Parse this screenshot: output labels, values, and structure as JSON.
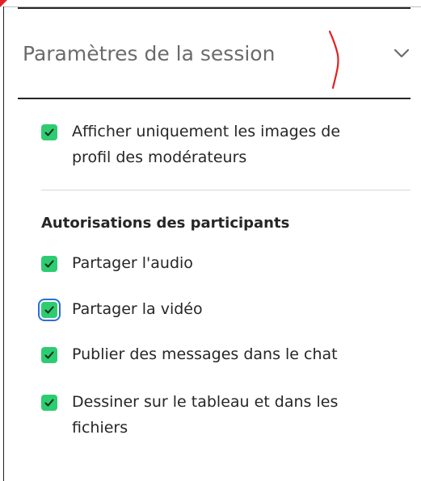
{
  "session_settings": {
    "header_title": "Paramètres de la session",
    "options": [
      {
        "label_lines": [
          "Afficher uniquement les images de",
          "profil des modérateurs"
        ],
        "checked": true
      }
    ]
  },
  "participant_permissions": {
    "title": "Autorisations des participants",
    "options": [
      {
        "label_lines": [
          "Partager l'audio"
        ],
        "checked": true
      },
      {
        "label_lines": [
          "Partager la vidéo"
        ],
        "checked": true,
        "focused": true
      },
      {
        "label_lines": [
          "Publier des messages dans le chat"
        ],
        "checked": true
      },
      {
        "label_lines": [
          "Dessiner sur le tableau et dans les",
          "fichiers"
        ],
        "checked": true
      }
    ]
  },
  "colors": {
    "checkbox_green": "#2ecc71",
    "focus_blue": "#2b6fd6",
    "annotation_red": "#e22222"
  },
  "icons": {
    "header_toggle": "chevron-down-icon",
    "checkbox_mark": "checkmark-icon"
  }
}
